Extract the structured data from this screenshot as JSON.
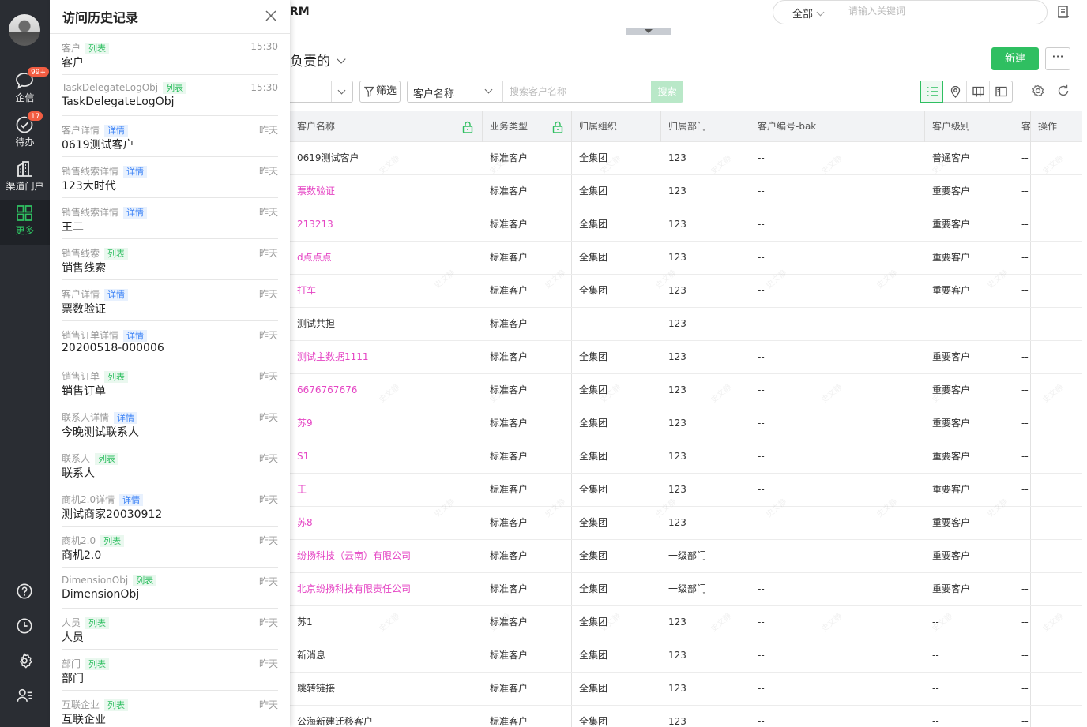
{
  "rail": {
    "items": [
      {
        "label": "企信",
        "badge": "99+"
      },
      {
        "label": "待办",
        "badge": "17"
      },
      {
        "label": "渠道门户",
        "badge": ""
      },
      {
        "label": "更多",
        "badge": ""
      }
    ]
  },
  "history": {
    "title": "访问历史记录",
    "items": [
      {
        "type": "客户",
        "tag": "列表",
        "tag_kind": "list",
        "name": "客户",
        "time": "15:30"
      },
      {
        "type": "TaskDelegateLogObj",
        "tag": "列表",
        "tag_kind": "list",
        "name": "TaskDelegateLogObj",
        "time": "15:30"
      },
      {
        "type": "客户详情",
        "tag": "详情",
        "tag_kind": "detail",
        "name": "0619测试客户",
        "time": "昨天"
      },
      {
        "type": "销售线索详情",
        "tag": "详情",
        "tag_kind": "detail",
        "name": "123大时代",
        "time": "昨天"
      },
      {
        "type": "销售线索详情",
        "tag": "详情",
        "tag_kind": "detail",
        "name": "王二",
        "time": "昨天"
      },
      {
        "type": "销售线索",
        "tag": "列表",
        "tag_kind": "list",
        "name": "销售线索",
        "time": "昨天"
      },
      {
        "type": "客户详情",
        "tag": "详情",
        "tag_kind": "detail",
        "name": "票数验证",
        "time": "昨天"
      },
      {
        "type": "销售订单详情",
        "tag": "详情",
        "tag_kind": "detail",
        "name": "20200518-000006",
        "time": "昨天"
      },
      {
        "type": "销售订单",
        "tag": "列表",
        "tag_kind": "list",
        "name": "销售订单",
        "time": "昨天"
      },
      {
        "type": "联系人详情",
        "tag": "详情",
        "tag_kind": "detail",
        "name": "今晚测试联系人",
        "time": "昨天"
      },
      {
        "type": "联系人",
        "tag": "列表",
        "tag_kind": "list",
        "name": "联系人",
        "time": "昨天"
      },
      {
        "type": "商机2.0详情",
        "tag": "详情",
        "tag_kind": "detail",
        "name": "测试商家20030912",
        "time": "昨天"
      },
      {
        "type": "商机2.0",
        "tag": "列表",
        "tag_kind": "list",
        "name": "商机2.0",
        "time": "昨天"
      },
      {
        "type": "DimensionObj",
        "tag": "列表",
        "tag_kind": "list",
        "name": "DimensionObj",
        "time": "昨天"
      },
      {
        "type": "人员",
        "tag": "列表",
        "tag_kind": "list",
        "name": "人员",
        "time": "昨天"
      },
      {
        "type": "部门",
        "tag": "列表",
        "tag_kind": "list",
        "name": "部门",
        "time": "昨天"
      },
      {
        "type": "互联企业",
        "tag": "列表",
        "tag_kind": "list",
        "name": "互联企业",
        "time": "昨天"
      }
    ]
  },
  "topbar": {
    "brand": "RM",
    "search_scope": "全部",
    "search_placeholder": "请输入关键词"
  },
  "toolbar": {
    "view_title": "负责的",
    "new_label": "新建",
    "more_label": "···",
    "filter_label": "筛选",
    "field_select": "客户名称",
    "kw_placeholder": "搜索客户名称",
    "search_label": "搜索"
  },
  "table": {
    "columns": [
      "客户名称",
      "业务类型",
      "归属组织",
      "归属部门",
      "客户编号-bak",
      "客户级别",
      "客",
      "操作"
    ],
    "rows": [
      {
        "name": "0619测试客户",
        "link": false,
        "biz": "标准客户",
        "org": "全集团",
        "dept": "123",
        "code": "--",
        "level": "普通客户",
        "extra": "--"
      },
      {
        "name": "票数验证",
        "link": true,
        "biz": "标准客户",
        "org": "全集团",
        "dept": "123",
        "code": "--",
        "level": "重要客户",
        "extra": "--"
      },
      {
        "name": "213213",
        "link": true,
        "biz": "标准客户",
        "org": "全集团",
        "dept": "123",
        "code": "--",
        "level": "重要客户",
        "extra": "--"
      },
      {
        "name": "d点点点",
        "link": true,
        "biz": "标准客户",
        "org": "全集团",
        "dept": "123",
        "code": "--",
        "level": "重要客户",
        "extra": "--"
      },
      {
        "name": "打车",
        "link": true,
        "biz": "标准客户",
        "org": "全集团",
        "dept": "123",
        "code": "--",
        "level": "重要客户",
        "extra": "--"
      },
      {
        "name": "测试共担",
        "link": false,
        "biz": "标准客户",
        "org": "--",
        "dept": "123",
        "code": "--",
        "level": "--",
        "extra": "--"
      },
      {
        "name": "测试主数据1111",
        "link": true,
        "biz": "标准客户",
        "org": "全集团",
        "dept": "123",
        "code": "--",
        "level": "重要客户",
        "extra": "--"
      },
      {
        "name": "6676767676",
        "link": true,
        "biz": "标准客户",
        "org": "全集团",
        "dept": "123",
        "code": "--",
        "level": "重要客户",
        "extra": "--"
      },
      {
        "name": "苏9",
        "link": true,
        "biz": "标准客户",
        "org": "全集团",
        "dept": "123",
        "code": "--",
        "level": "重要客户",
        "extra": "--"
      },
      {
        "name": "S1",
        "link": true,
        "biz": "标准客户",
        "org": "全集团",
        "dept": "123",
        "code": "--",
        "level": "重要客户",
        "extra": "--"
      },
      {
        "name": "王一",
        "link": true,
        "biz": "标准客户",
        "org": "全集团",
        "dept": "123",
        "code": "--",
        "level": "重要客户",
        "extra": "--"
      },
      {
        "name": "苏8",
        "link": true,
        "biz": "标准客户",
        "org": "全集团",
        "dept": "123",
        "code": "--",
        "level": "重要客户",
        "extra": "--"
      },
      {
        "name": "纷扬科技（云南）有限公司",
        "link": true,
        "biz": "标准客户",
        "org": "全集团",
        "dept": "一级部门",
        "code": "--",
        "level": "重要客户",
        "extra": "--"
      },
      {
        "name": "北京纷扬科技有限责任公司",
        "link": true,
        "biz": "标准客户",
        "org": "全集团",
        "dept": "一级部门",
        "code": "--",
        "level": "重要客户",
        "extra": "--"
      },
      {
        "name": "苏1",
        "link": false,
        "biz": "标准客户",
        "org": "全集团",
        "dept": "123",
        "code": "--",
        "level": "--",
        "extra": "--"
      },
      {
        "name": "新消息",
        "link": false,
        "biz": "标准客户",
        "org": "全集团",
        "dept": "123",
        "code": "--",
        "level": "--",
        "extra": "--"
      },
      {
        "name": "跳转链接",
        "link": false,
        "biz": "标准客户",
        "org": "全集团",
        "dept": "123",
        "code": "--",
        "level": "--",
        "extra": "--"
      },
      {
        "name": "公海新建迁移客户",
        "link": false,
        "biz": "标准客户",
        "org": "全集团",
        "dept": "123",
        "code": "--",
        "level": "--",
        "extra": "--"
      }
    ]
  },
  "colors": {
    "accent": "#2fbf61",
    "link": "#e545c4",
    "rail_bg": "#2a2d33",
    "badge": "#f25d42"
  }
}
